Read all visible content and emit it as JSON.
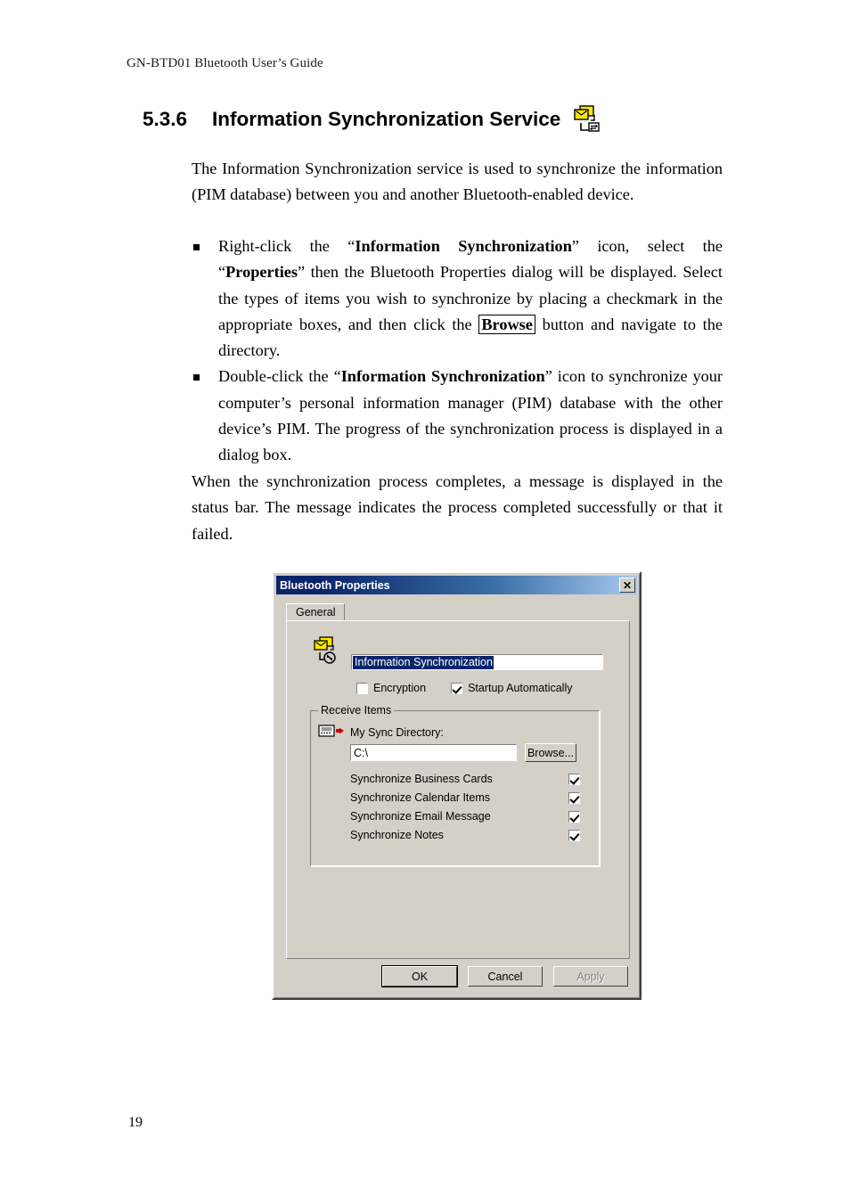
{
  "page": {
    "running_header": "GN-BTD01 Bluetooth User’s Guide",
    "page_number": "19"
  },
  "section": {
    "number": "5.3.6",
    "title": "Information Synchronization Service",
    "icon": "information-sync-icon"
  },
  "intro_paragraph": "The Information Synchronization service is used to synchronize the information (PIM database) between you and another Bluetooth-enabled device.",
  "bullets": [
    {
      "seg1": "Right-click the “",
      "bold1": "Information Synchronization",
      "seg2": "” icon, select the “",
      "bold2": "Properties",
      "seg3": "” then the Bluetooth Properties dialog will be displayed. Select the types of items you wish to synchronize by placing a checkmark in the appropriate boxes, and then click the ",
      "button_label": "Browse",
      "seg4": " button and navigate to the directory."
    },
    {
      "seg1": "Double-click the “",
      "bold1": "Information Synchronization",
      "seg2": "” icon to synchronize your computer’s personal information manager (PIM) database with the other device’s PIM. The progress of the synchronization process is displayed in a dialog box."
    }
  ],
  "closing_paragraph": "When the synchronization process completes, a message is displayed in the status bar. The message indicates the process completed successfully or that it failed.",
  "dialog": {
    "title": "Bluetooth Properties",
    "close_label": "✕",
    "tab": "General",
    "service_icon": "information-sync-icon",
    "service_name_value": "Information Synchronization",
    "options": [
      {
        "label": "Encryption",
        "checked": false
      },
      {
        "label": "Startup Automatically",
        "checked": true
      }
    ],
    "group": {
      "title": "Receive Items",
      "sync_dir_icon": "sync-device-arrow-icon",
      "sync_dir_label": "My Sync Directory:",
      "dir_value": "C:\\",
      "browse_label": "Browse...",
      "items": [
        {
          "label": "Synchronize Business Cards",
          "checked": true
        },
        {
          "label": "Synchronize Calendar Items",
          "checked": true
        },
        {
          "label": "Synchronize Email Message",
          "checked": true
        },
        {
          "label": "Synchronize Notes",
          "checked": true
        }
      ]
    },
    "buttons": {
      "ok": "OK",
      "cancel": "Cancel",
      "apply": "Apply"
    }
  },
  "colors": {
    "titlebar_start": "#0a246a",
    "titlebar_end": "#a6caf0",
    "dialog_face": "#d4d0c8",
    "selection": "#0a246a",
    "icon_yellow": "#ffe800",
    "arrow_red": "#cc0000"
  }
}
